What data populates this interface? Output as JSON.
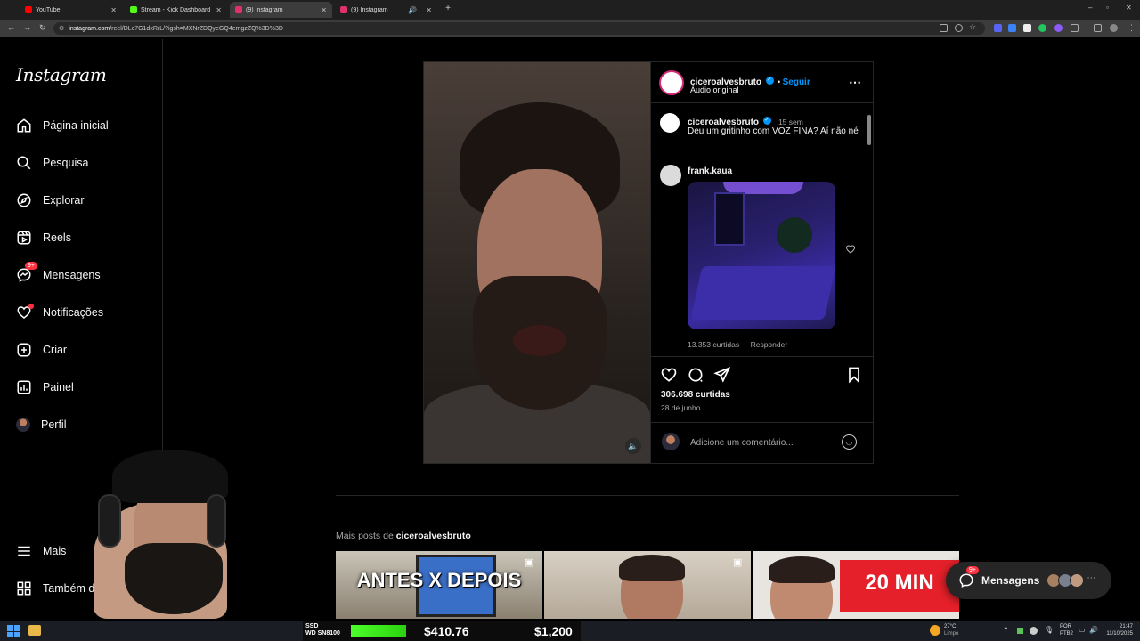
{
  "browser": {
    "tabs": [
      {
        "title": "YouTube",
        "favicon_color": "#ff0000",
        "active": false
      },
      {
        "title": "Stream - Kick Dashboard",
        "favicon_color": "#53fc18",
        "active": false
      },
      {
        "title": "(9) Instagram",
        "favicon_color": "#e1306c",
        "active": true
      },
      {
        "title": "(9) Instagram",
        "favicon_color": "#e1306c",
        "active": false
      }
    ],
    "url_host": "instagram.com",
    "url_path": "/reel/DLc7G1dxRrL/?igsh=MXNrZDQyeGQ4emgzZQ%3D%3D"
  },
  "sidebar": {
    "logo": "Instagram",
    "items": [
      {
        "label": "Página inicial",
        "icon": "home-icon"
      },
      {
        "label": "Pesquisa",
        "icon": "search-icon"
      },
      {
        "label": "Explorar",
        "icon": "compass-icon"
      },
      {
        "label": "Reels",
        "icon": "reels-icon"
      },
      {
        "label": "Mensagens",
        "icon": "messenger-icon",
        "badge": "9+"
      },
      {
        "label": "Notificações",
        "icon": "heart-icon",
        "dot": true
      },
      {
        "label": "Criar",
        "icon": "plus-square-icon"
      },
      {
        "label": "Painel",
        "icon": "dashboard-icon"
      },
      {
        "label": "Perfil",
        "icon": "avatar"
      }
    ],
    "more": "Mais",
    "meta": "Também da Meta"
  },
  "post": {
    "username": "ciceroalvesbruto",
    "follow_label": "Seguir",
    "audio": "Áudio original",
    "caption_user": "ciceroalvesbruto",
    "caption_age": "15 sem",
    "caption_text": "Deu um gritinho com VOZ FINA? Aí não né",
    "comment_user": "frank.kaua",
    "comment_likes": "13.353 curtidas",
    "reply_label": "Responder",
    "likes": "306.698 curtidas",
    "date": "28 de junho",
    "comment_placeholder": "Adicione um comentário..."
  },
  "more_posts": {
    "prefix": "Mais posts de",
    "username": "ciceroalvesbruto",
    "cards": [
      {
        "caption": "ANTES X DEPOIS"
      },
      {
        "caption": ""
      },
      {
        "caption": "20 MIN"
      }
    ]
  },
  "messages_pill": {
    "label": "Mensagens",
    "badge": "9+"
  },
  "overlay": {
    "ssd_label": "SSD",
    "wd_label": "WD SN8100",
    "price1": "$410.76",
    "price2": "$1,200"
  },
  "taskbar": {
    "weather_temp": "27°C",
    "weather_desc": "Limpo",
    "lang": "POR",
    "layout": "PTB2",
    "time": "21:47",
    "date": "11/10/2025"
  }
}
